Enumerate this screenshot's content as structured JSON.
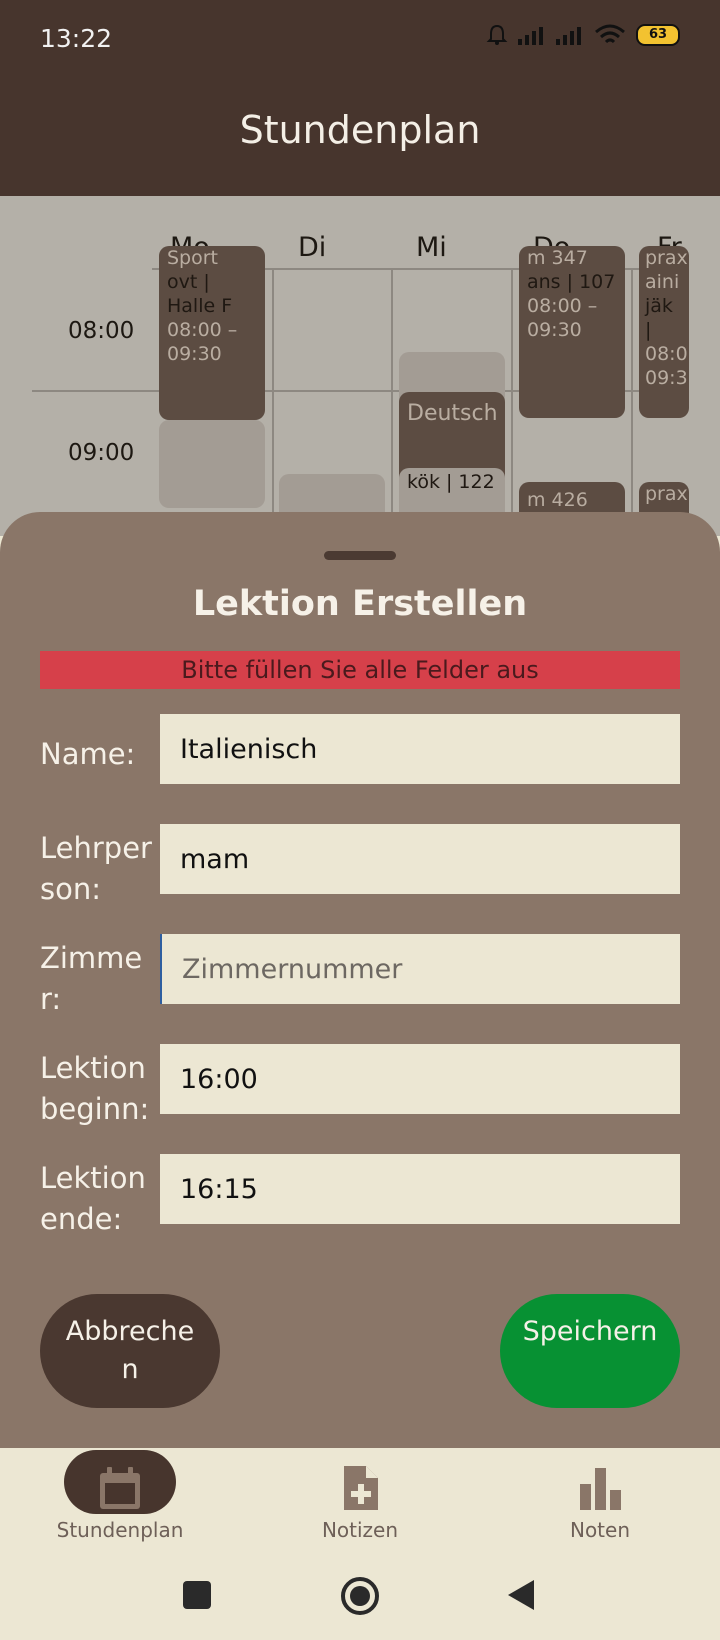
{
  "status_bar": {
    "time": "13:22",
    "battery": "63"
  },
  "app_bar": {
    "title": "Stundenplan"
  },
  "timetable": {
    "days": [
      "Mo",
      "Di",
      "Mi",
      "Do",
      "Fr"
    ],
    "times": [
      "08:00",
      "09:00"
    ],
    "lessons": {
      "mo_1": {
        "title": "Sport",
        "room": "ovt | Halle F",
        "time": "08:00 – 09:30"
      },
      "do_1": {
        "title": "m 347",
        "room": "ans | 107",
        "time": "08:00 – 09:30"
      },
      "fr_1": {
        "title": "prax",
        "room": "aini",
        "room2": "jäk |",
        "time": "08:0",
        "time2": "09:3"
      },
      "mi_2": {
        "title": "Deutsch",
        "room": "kök | 122"
      },
      "do_3": {
        "title": "m 426"
      },
      "fr_3": {
        "title": "prax"
      }
    }
  },
  "sheet": {
    "title": "Lektion Erstellen",
    "error": "Bitte füllen Sie alle Felder aus",
    "fields": {
      "name": {
        "label": "Name:",
        "value": "Italienisch",
        "placeholder": ""
      },
      "teacher": {
        "label": "Lehrperson:",
        "value": "mam",
        "placeholder": ""
      },
      "room": {
        "label": "Zimmer:",
        "value": "",
        "placeholder": "Zimmernummer"
      },
      "start": {
        "label": "Lektion beginn:",
        "value": "16:00",
        "placeholder": ""
      },
      "end": {
        "label": "Lektion ende:",
        "value": "16:15",
        "placeholder": ""
      }
    },
    "cancel_label": "Abbrechen",
    "save_label": "Speichern"
  },
  "bottom_nav": [
    {
      "label": "Stundenplan",
      "icon": "calendar-icon",
      "active": true
    },
    {
      "label": "Notizen",
      "icon": "note-add-icon",
      "active": false
    },
    {
      "label": "Noten",
      "icon": "bar-chart-icon",
      "active": false
    }
  ],
  "colors": {
    "app_bar": "#47352D",
    "sheet": "#8A7668",
    "error": "#D6404A",
    "save": "#079133",
    "cancel": "#4A3830"
  }
}
